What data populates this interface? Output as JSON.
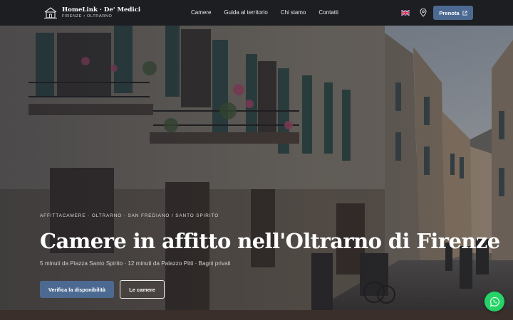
{
  "brand": {
    "name": "HomeLink · De' Medici",
    "subtitle": "FIRENZE • OLTRARNO"
  },
  "nav": {
    "items": [
      {
        "label": "Camere"
      },
      {
        "label": "Guida al territorio"
      },
      {
        "label": "Chi siamo"
      },
      {
        "label": "Contatti"
      }
    ],
    "language_icon": "uk-flag-icon",
    "location_icon": "map-pin-icon",
    "book_label": "Prenota",
    "book_icon": "external-link-icon"
  },
  "hero": {
    "eyebrow": "AFFITTACAMERE · OLTRARNO · SAN FREDIANO / SANTO SPIRITO",
    "title": "Camere in affitto nell'Oltrarno di Firenze",
    "subtitle": "5 minuti da Piazza Santo Spirito · 12 minuti da Palazzo Pitti · Bagni privati",
    "primary_button": "Verifica la disponibilità",
    "secondary_button": "Le camere"
  },
  "floating": {
    "whatsapp_icon": "whatsapp-icon"
  },
  "colors": {
    "accent": "#4c6a91",
    "nav_bg": "#1d1e22",
    "whatsapp": "#25d366"
  }
}
